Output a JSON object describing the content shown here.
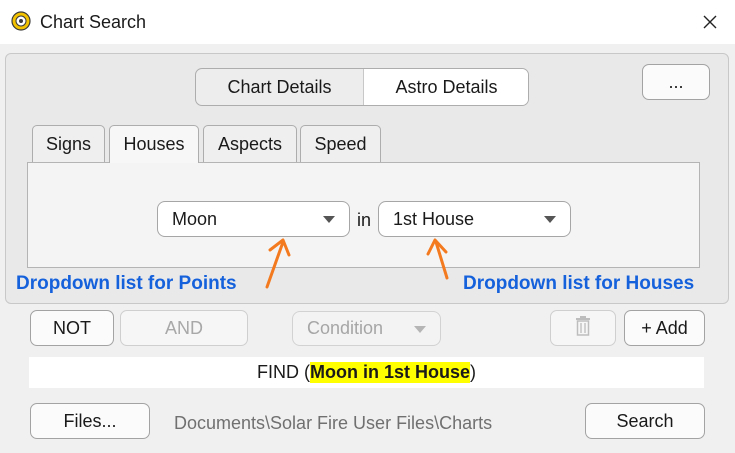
{
  "window": {
    "title": "Chart Search",
    "icon": "app-sun-icon",
    "close_icon": "close-icon"
  },
  "segment": {
    "chart_details": "Chart Details",
    "astro_details": "Astro Details",
    "selected": "Astro Details"
  },
  "more_button": "...",
  "tabs": [
    {
      "label": "Signs",
      "active": false
    },
    {
      "label": "Houses",
      "active": true
    },
    {
      "label": "Aspects",
      "active": false
    },
    {
      "label": "Speed",
      "active": false
    }
  ],
  "criteria": {
    "point_value": "Moon",
    "in_label": "in",
    "house_value": "1st House"
  },
  "annotations": {
    "points_label": "Dropdown list for Points",
    "houses_label": "Dropdown list for Houses",
    "color": "#1561dc",
    "arrow_color": "#f47a1f"
  },
  "logic": {
    "not_label": "NOT",
    "and_label": "AND",
    "condition_placeholder": "Condition",
    "delete_icon": "trash-icon",
    "add_label": "+ Add"
  },
  "find": {
    "prefix": "FIND (",
    "expression": "Moon in 1st House",
    "suffix": ")",
    "highlight_color": "#ffff00"
  },
  "footer": {
    "files_label": "Files...",
    "path": "Documents\\Solar Fire User Files\\Charts",
    "search_label": "Search"
  }
}
